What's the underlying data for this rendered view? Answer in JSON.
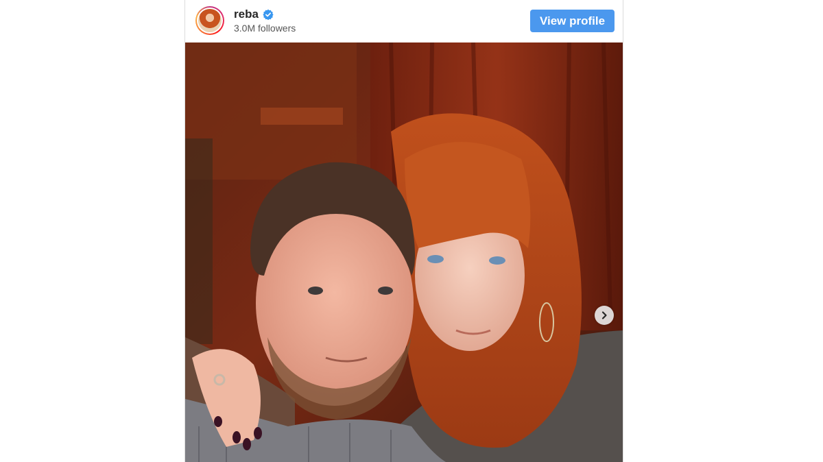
{
  "profile": {
    "username": "reba",
    "followers": "3.0M followers",
    "verified": true,
    "view_profile_label": "View profile"
  },
  "post": {
    "image_alt": "Photo of two people posing together"
  },
  "icons": {
    "verified": "verified-badge-icon",
    "next": "chevron-right-icon"
  },
  "colors": {
    "button": "#4b98ee",
    "verified": "#3897f0",
    "avatar_ring": "#c13584"
  }
}
